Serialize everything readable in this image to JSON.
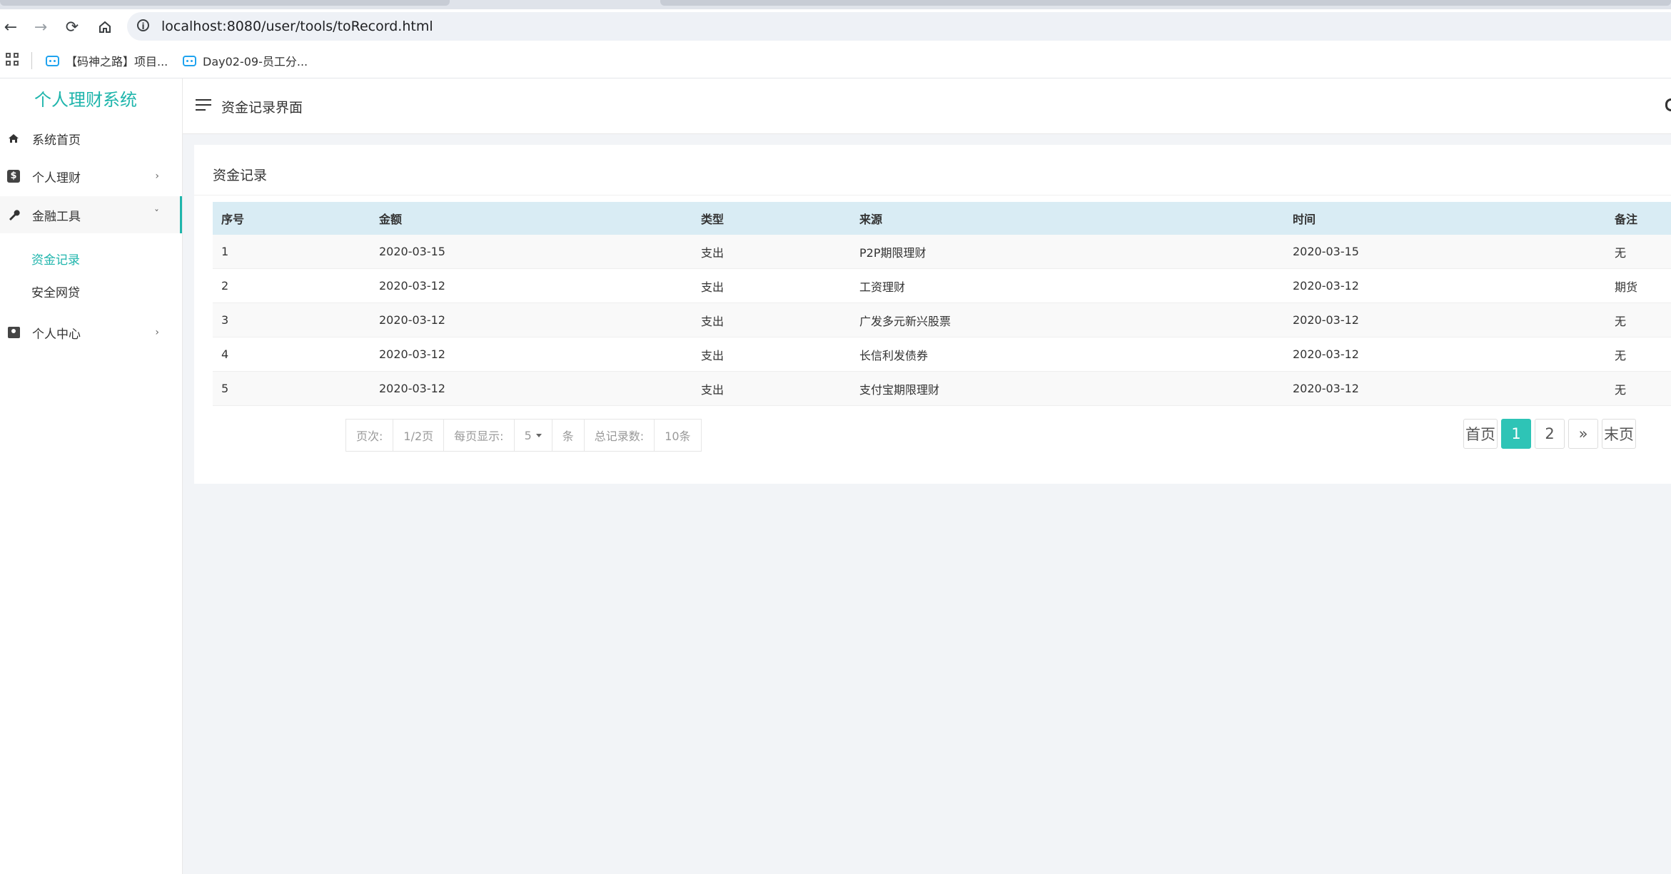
{
  "browser": {
    "url": "localhost:8080/user/tools/toRecord.html",
    "bookmarks": [
      "【码神之路】项目...",
      "Day02-09-员工分..."
    ]
  },
  "app": {
    "logo": "个人理财系统"
  },
  "sidebar": {
    "items": [
      {
        "label": "系统首页",
        "icon": "home-icon"
      },
      {
        "label": "个人理财",
        "icon": "dollar-icon"
      },
      {
        "label": "金融工具",
        "icon": "wrench-icon"
      },
      {
        "label": "个人中心",
        "icon": "contact-icon"
      }
    ],
    "submenu": [
      {
        "label": "资金记录",
        "active": true
      },
      {
        "label": "安全网贷",
        "active": false
      }
    ]
  },
  "header": {
    "title": "资金记录界面"
  },
  "card": {
    "title": "资金记录"
  },
  "table": {
    "columns": [
      "序号",
      "金额",
      "类型",
      "来源",
      "时间",
      "备注"
    ],
    "rows": [
      [
        "1",
        "2020-03-15",
        "支出",
        "P2P期限理财",
        "2020-03-15",
        "无"
      ],
      [
        "2",
        "2020-03-12",
        "支出",
        "工资理财",
        "2020-03-12",
        "期货"
      ],
      [
        "3",
        "2020-03-12",
        "支出",
        "广发多元新兴股票",
        "2020-03-12",
        "无"
      ],
      [
        "4",
        "2020-03-12",
        "支出",
        "长信利发债券",
        "2020-03-12",
        "无"
      ],
      [
        "5",
        "2020-03-12",
        "支出",
        "支付宝期限理财",
        "2020-03-12",
        "无"
      ]
    ]
  },
  "pager": {
    "page_label": "页次:",
    "page_value": "1/2页",
    "per_page_label": "每页显示:",
    "per_page_value": "5",
    "per_page_unit": "条",
    "total_label": "总记录数:",
    "total_value": "10条"
  },
  "pagination": {
    "first": "首页",
    "pages": [
      "1",
      "2"
    ],
    "current": "1",
    "next": "»",
    "last": "末页"
  },
  "colors": {
    "accent": "#1fb5ac",
    "table_header": "#d9ecf4",
    "page_active": "#2ec4b6"
  }
}
